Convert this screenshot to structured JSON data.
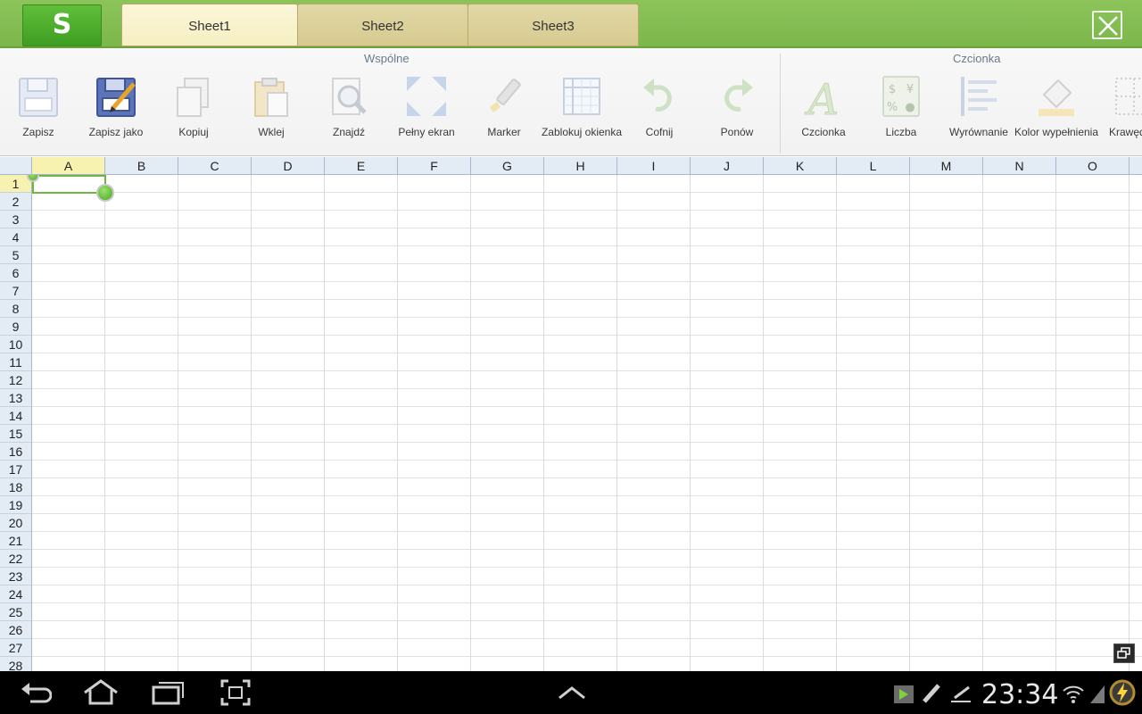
{
  "app": {
    "logo_letter": "S",
    "accent_color": "#7cb74c"
  },
  "tabs": [
    {
      "label": "Sheet1",
      "active": true
    },
    {
      "label": "Sheet2",
      "active": false
    },
    {
      "label": "Sheet3",
      "active": false
    }
  ],
  "ribbon": {
    "groups": [
      {
        "title": "Wspólne"
      },
      {
        "title": "Czcionka"
      }
    ],
    "buttons": [
      {
        "label": "Zapisz",
        "icon": "floppy-disk-icon"
      },
      {
        "label": "Zapisz jako",
        "icon": "save-as-icon"
      },
      {
        "label": "Kopiuj",
        "icon": "copy-icon"
      },
      {
        "label": "Wklej",
        "icon": "paste-icon"
      },
      {
        "label": "Znajdź",
        "icon": "magnifier-icon"
      },
      {
        "label": "Pełny ekran",
        "icon": "fullscreen-icon"
      },
      {
        "label": "Marker",
        "icon": "marker-icon"
      },
      {
        "label": "Zablokuj okienka",
        "icon": "freeze-panes-icon"
      },
      {
        "label": "Cofnij",
        "icon": "undo-icon"
      },
      {
        "label": "Ponów",
        "icon": "redo-icon"
      },
      {
        "label": "Czcionka",
        "icon": "font-icon"
      },
      {
        "label": "Liczba",
        "icon": "number-format-icon"
      },
      {
        "label": "Wyrównanie",
        "icon": "align-icon"
      },
      {
        "label": "Kolor wypełnienia",
        "icon": "fill-color-icon"
      },
      {
        "label": "Krawędzie",
        "icon": "borders-icon"
      }
    ]
  },
  "grid": {
    "columns": [
      "A",
      "B",
      "C",
      "D",
      "E",
      "F",
      "G",
      "H",
      "I",
      "J",
      "K",
      "L",
      "M",
      "N",
      "O"
    ],
    "rows": [
      "1",
      "2",
      "3",
      "4",
      "5",
      "6",
      "7",
      "8",
      "9",
      "10",
      "11",
      "12",
      "13",
      "14",
      "15",
      "16",
      "17",
      "18",
      "19",
      "20",
      "21",
      "22",
      "23",
      "24",
      "25",
      "26",
      "27",
      "28"
    ],
    "selected_cell": "A1"
  },
  "status_bar": {
    "time": "23:34"
  }
}
